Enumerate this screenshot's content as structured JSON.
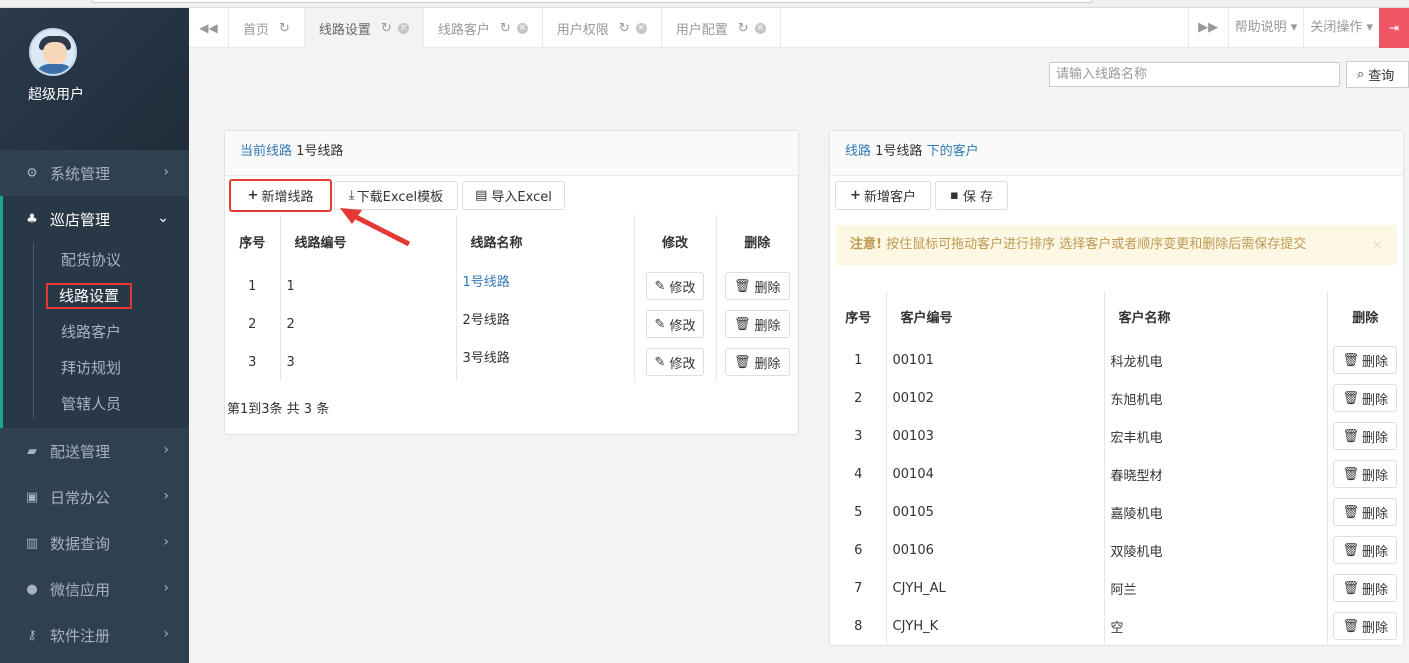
{
  "user": {
    "name": "超级用户"
  },
  "sidebar": {
    "items": [
      {
        "label": "系统管理"
      },
      {
        "label": "巡店管理"
      },
      {
        "label": "配送管理"
      },
      {
        "label": "日常办公"
      },
      {
        "label": "数据查询"
      },
      {
        "label": "微信应用"
      },
      {
        "label": "软件注册"
      }
    ],
    "submenu": [
      "配货协议",
      "线路设置",
      "线路客户",
      "拜访规划",
      "管辖人员"
    ]
  },
  "tabs": [
    {
      "label": "首页"
    },
    {
      "label": "线路设置"
    },
    {
      "label": "线路客户"
    },
    {
      "label": "用户权限"
    },
    {
      "label": "用户配置"
    }
  ],
  "tabbar_right": {
    "help": "帮助说明",
    "close_ops": "关闭操作"
  },
  "search": {
    "placeholder": "请输入线路名称",
    "button": "查询"
  },
  "left_panel": {
    "head_link": "当前线路",
    "head_value": "1号线路",
    "buttons": {
      "add": "新增线路",
      "download": "下载Excel模板",
      "import": "导入Excel"
    },
    "columns": [
      "序号",
      "线路编号",
      "线路名称",
      "修改",
      "删除"
    ],
    "rows": [
      {
        "seq": "1",
        "code": "1",
        "name": "1号线路"
      },
      {
        "seq": "2",
        "code": "2",
        "name": "2号线路"
      },
      {
        "seq": "3",
        "code": "3",
        "name": "3号线路"
      }
    ],
    "edit_label": "修改",
    "delete_label": "删除",
    "pagination": "第1到3条 共 3 条"
  },
  "right_panel": {
    "head_link1": "线路",
    "head_value": "1号线路",
    "head_link2": "下的客户",
    "buttons": {
      "add": "新增客户",
      "save": "保 存"
    },
    "alert_strong": "注意!",
    "alert_text": "按住鼠标可拖动客户进行排序 选择客户或者顺序变更和删除后需保存提交",
    "columns": [
      "序号",
      "客户编号",
      "客户名称",
      "删除"
    ],
    "rows": [
      {
        "seq": "1",
        "code": "00101",
        "name": "科龙机电"
      },
      {
        "seq": "2",
        "code": "00102",
        "name": "东旭机电"
      },
      {
        "seq": "3",
        "code": "00103",
        "name": "宏丰机电"
      },
      {
        "seq": "4",
        "code": "00104",
        "name": "春晓型材"
      },
      {
        "seq": "5",
        "code": "00105",
        "name": "嘉陵机电"
      },
      {
        "seq": "6",
        "code": "00106",
        "name": "双陵机电"
      },
      {
        "seq": "7",
        "code": "CJYH_AL",
        "name": "阿兰"
      },
      {
        "seq": "8",
        "code": "CJYH_K",
        "name": "空"
      }
    ],
    "delete_label": "删除"
  },
  "colors": {
    "sidebar": "#2f4050",
    "link": "#337ab7",
    "highlight": "#e53935",
    "alert_bg": "#fcf8e3"
  }
}
